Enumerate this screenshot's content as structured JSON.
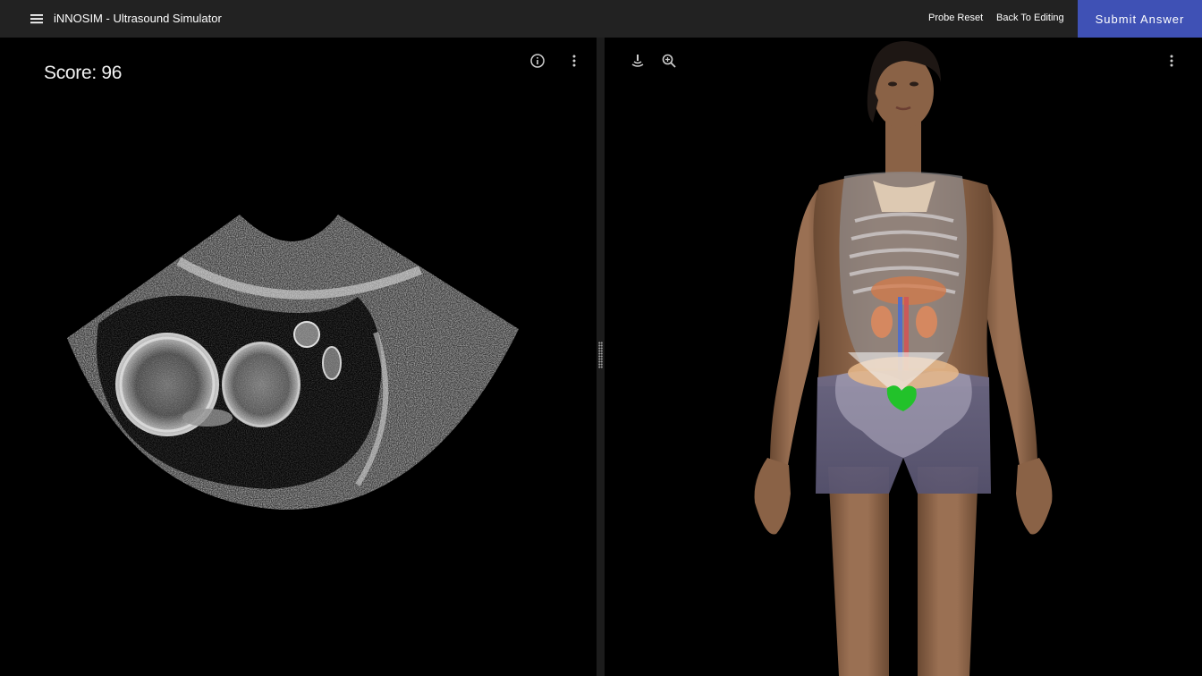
{
  "app": {
    "title": "iNNOSIM - Ultrasound Simulator"
  },
  "header": {
    "menu_icon": "hamburger-menu-icon",
    "probe_reset_label": "Probe Reset",
    "back_to_editing_label": "Back To Editing",
    "submit_label": "Submit Answer"
  },
  "ultrasound_panel": {
    "score_text": "Score: 96",
    "info_icon": "info-icon",
    "more_icon": "more-vert-icon"
  },
  "anatomy_panel": {
    "probe_icon": "probe-icon",
    "zoom_icon": "zoom-in-icon",
    "more_icon": "more-vert-icon"
  },
  "colors": {
    "topbar": "#222222",
    "accent": "#3f51b5",
    "background": "#000000",
    "probe_target": "#22c22a"
  }
}
